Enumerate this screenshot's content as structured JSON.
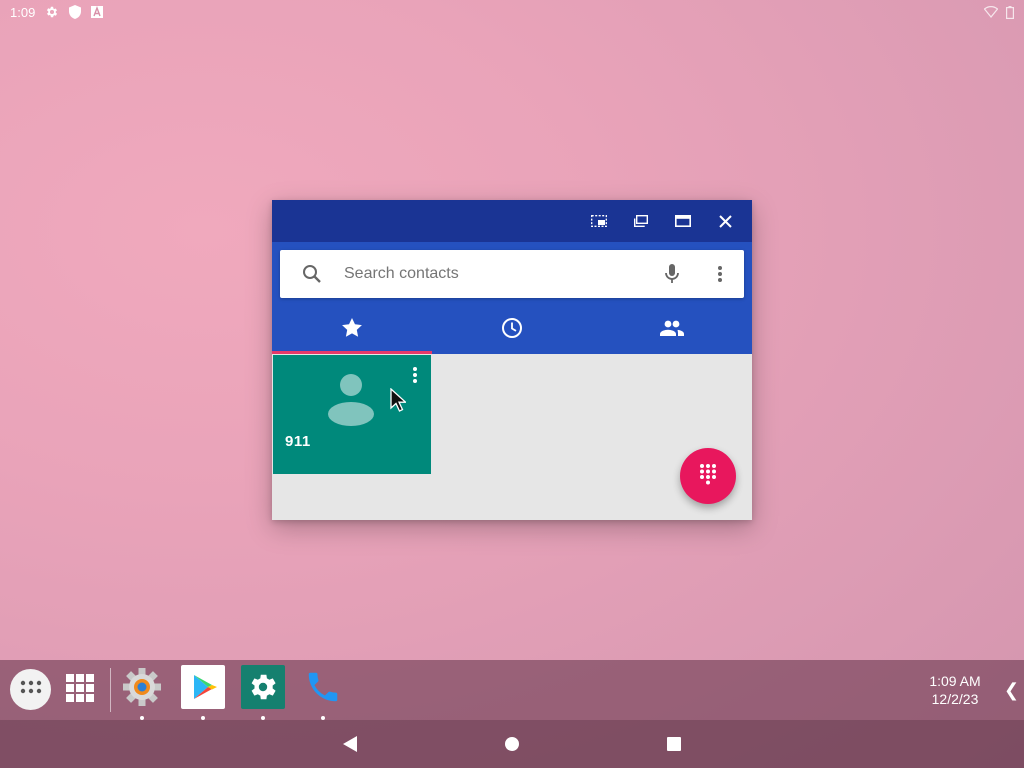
{
  "status_bar": {
    "time": "1:09",
    "icons": [
      "gear-icon",
      "shield-icon",
      "a-icon"
    ],
    "right_icons": [
      "wifi-icon",
      "battery-icon"
    ]
  },
  "window": {
    "title_buttons": [
      "picture-in-picture-icon",
      "restore-window-icon",
      "maximize-icon",
      "close-icon"
    ],
    "search": {
      "placeholder": "Search contacts"
    },
    "tabs": [
      {
        "name": "favorites",
        "icon": "star-icon",
        "active": true
      },
      {
        "name": "recents",
        "icon": "clock-icon",
        "active": false
      },
      {
        "name": "contacts",
        "icon": "people-icon",
        "active": false
      }
    ],
    "favorites": [
      {
        "name": "911"
      }
    ],
    "colors": {
      "title_bar": "#1a3494",
      "header": "#2551bf",
      "tile": "#00897b",
      "fab": "#e8175d",
      "tab_indicator": "#e53a6a"
    }
  },
  "taskbar": {
    "pinned_apps": [
      "settings-app-icon",
      "play-store-icon",
      "settings-gear-icon",
      "phone-icon"
    ],
    "clock": {
      "time": "1:09 AM",
      "date": "12/2/23"
    },
    "tray_arrow": "❮"
  },
  "nav_bar": {
    "buttons": [
      "back-icon",
      "home-icon",
      "recents-icon"
    ]
  }
}
